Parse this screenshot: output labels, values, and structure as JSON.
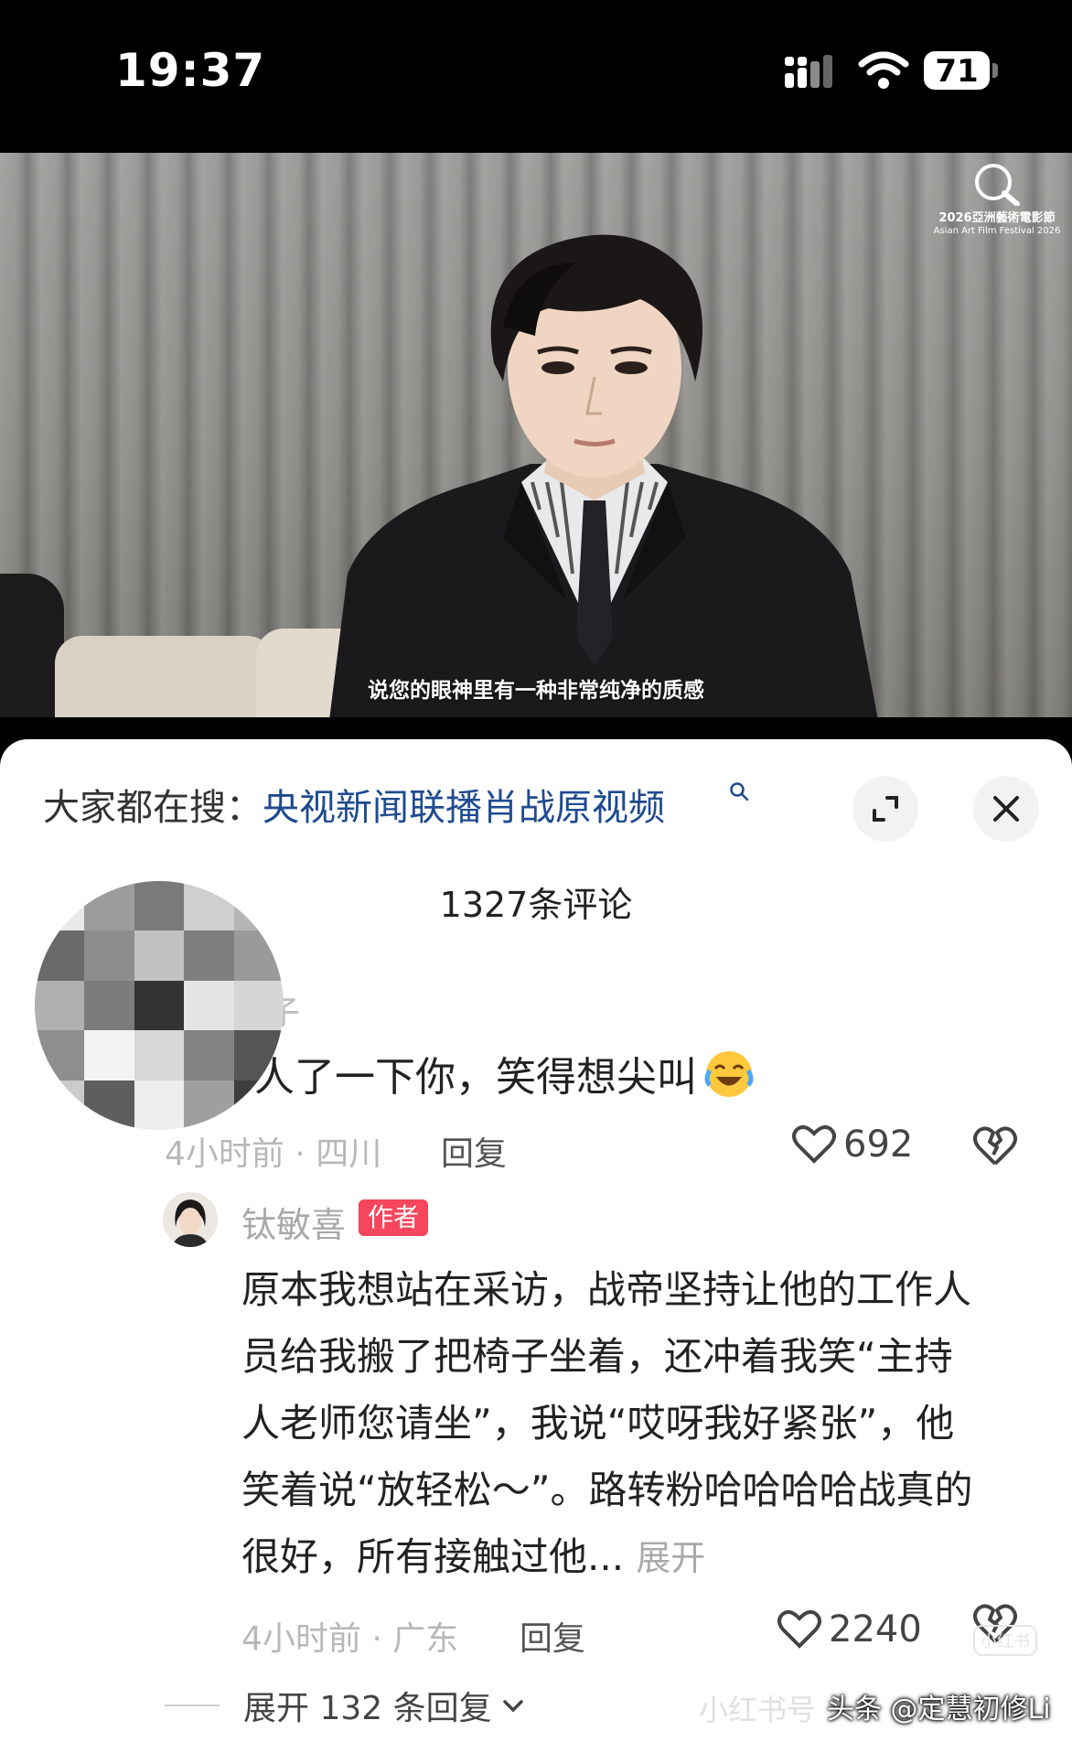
{
  "status_bar": {
    "time": "19:37",
    "battery": "71"
  },
  "video": {
    "subtitle": "说您的眼神里有一种非常纯净的质感",
    "festival_logo_cn": "2026亞洲藝術電影節",
    "festival_logo_en": "Asian Art Film Festival 2026"
  },
  "search_bar": {
    "prefix": "大家都在搜：",
    "query": "央视新闻联播肖战原视频"
  },
  "comments_header": {
    "count_label": "1327条评论"
  },
  "comment1": {
    "username_visible": "子",
    "text": "人了一下你，笑得想尖叫",
    "emoji": "laughing-crying-emoji",
    "meta": "4小时前 · 四川",
    "reply_label": "回复",
    "likes": "692"
  },
  "reply1": {
    "author": "钛敏喜",
    "author_tag": "作者",
    "lines": [
      "原本我想站在采访，战帝坚持让他的工作人",
      "员给我搬了把椅子坐着，还冲着我笑“主持",
      "人老师您请坐”，我说“哎呀我好紧张”，他",
      "笑着说“放轻松～”。路转粉哈哈哈哈战真的",
      "很好，所有接触过他..."
    ],
    "expand_label": "展开",
    "meta": "4小时前 · 广东",
    "reply_label": "回复",
    "likes": "2240"
  },
  "expand_replies": {
    "label": "展开 132 条回复"
  },
  "watermarks": {
    "xiaohongshu": "小红书号",
    "toutiao": "头条 @定慧初修Li",
    "logo": "小红书"
  },
  "colors": {
    "search_query": "#1f4b8e",
    "author_tag": "#f5465d",
    "meta_gray": "#b8b8b8"
  }
}
